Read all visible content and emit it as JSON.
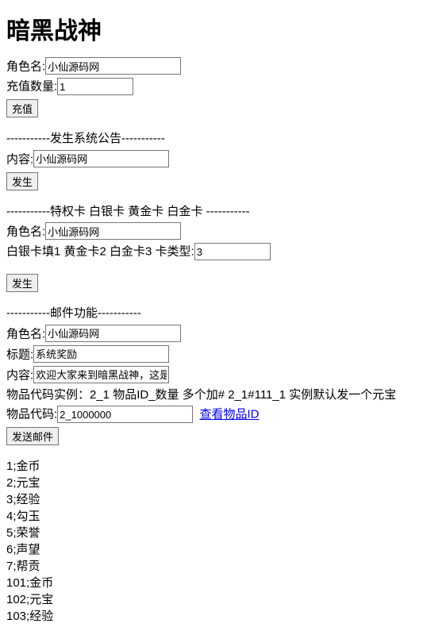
{
  "title": "暗黑战神",
  "recharge": {
    "role_label": "角色名:",
    "role_value": "小仙源码网",
    "qty_label": "充值数量:",
    "qty_value": "1",
    "button": "充值"
  },
  "announce": {
    "divider": "-----------发生系统公告-----------",
    "content_label": "内容:",
    "content_value": "小仙源码网",
    "button": "发生"
  },
  "card": {
    "divider": "-----------特权卡 白银卡 黄金卡 白金卡 -----------",
    "role_label": "角色名:",
    "role_value": "小仙源码网",
    "hint": "白银卡填1 黄金卡2 白金卡3 卡类型:",
    "type_value": "3",
    "button": "发生"
  },
  "mail": {
    "divider": "-----------邮件功能-----------",
    "role_label": "角色名:",
    "role_value": "小仙源码网",
    "title_label": "标题:",
    "title_value": "系统奖励",
    "content_label": "内容:",
    "content_value": "欢迎大家来到暗黑战神，这是",
    "example": "物品代码实例：2_1 物品ID_数量 多个加# 2_1#111_1 实例默认发一个元宝",
    "code_label": "物品代码:",
    "code_value": "2_1000000",
    "link": "查看物品ID",
    "button": "发送邮件"
  },
  "items": [
    "1;金币",
    "2;元宝",
    "3;经验",
    "4;勾玉",
    "5;荣誉",
    "6;声望",
    "7;帮贡",
    "101;金币",
    "102;元宝",
    "103;经验"
  ]
}
